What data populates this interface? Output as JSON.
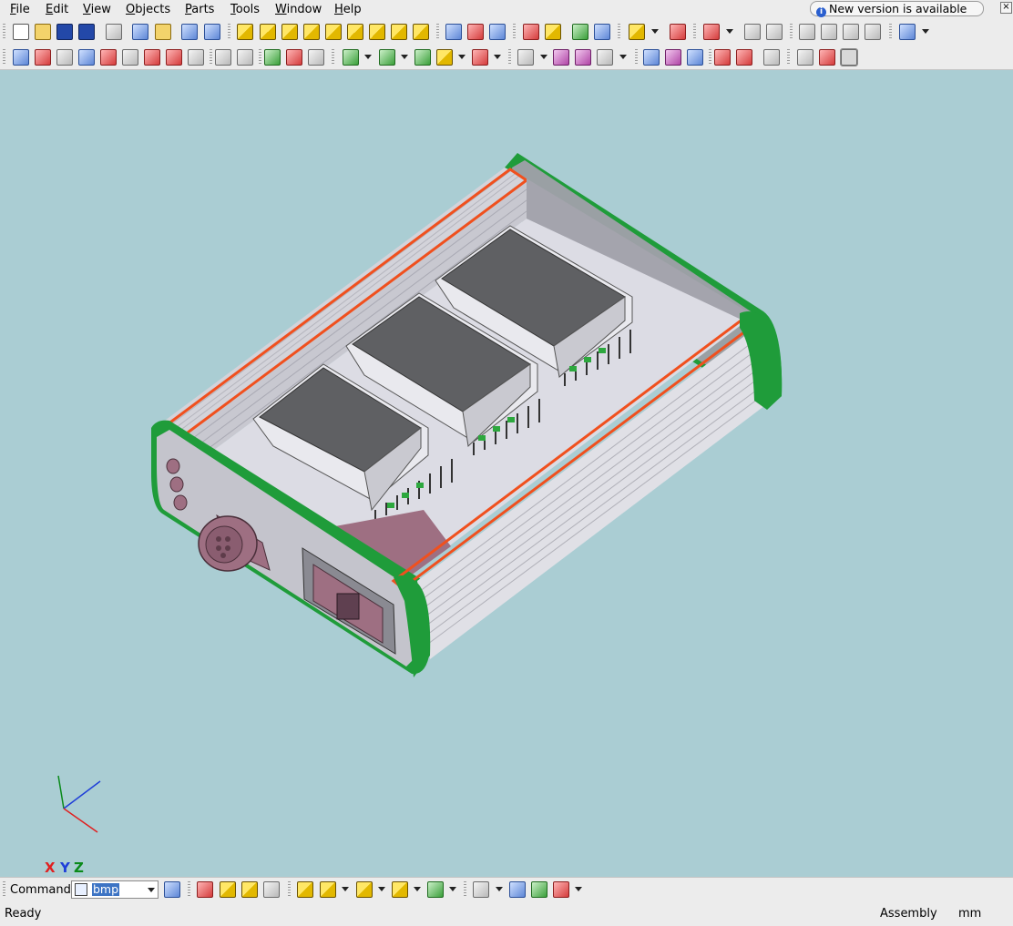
{
  "menubar": {
    "items": [
      "File",
      "Edit",
      "View",
      "Objects",
      "Parts",
      "Tools",
      "Window",
      "Help"
    ],
    "underlines": [
      "F",
      "E",
      "V",
      "O",
      "P",
      "T",
      "W",
      "H"
    ],
    "rests": [
      "ile",
      "dit",
      "iew",
      "bjects",
      "arts",
      "ools",
      "indow",
      "elp"
    ]
  },
  "notification": {
    "text": "New version is available",
    "close": "×"
  },
  "toolbar": {
    "icons": {
      "new": "new-document-icon",
      "open": "open-folder-icon",
      "save": "save-icon",
      "print": "print-icon",
      "undo": "undo-icon",
      "redo": "redo-icon",
      "export": "export-icon"
    }
  },
  "viewport": {
    "background": "#aacdd3",
    "model_colors": {
      "enclosure": "#e0e0e6",
      "end_caps": "#1f9c3a",
      "seal": "#f0501e",
      "heatsinks": "#5f6063",
      "connectors": "#9e6f82"
    }
  },
  "axes": {
    "x": "X",
    "y": "Y",
    "z": "Z"
  },
  "command": {
    "label": "Command:",
    "value": "bmp"
  },
  "status": {
    "message": "Ready",
    "mode": "Assembly",
    "units": "mm"
  }
}
